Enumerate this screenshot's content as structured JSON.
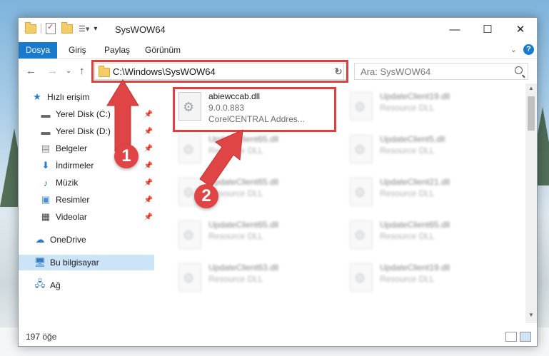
{
  "window": {
    "title": "SysWOW64"
  },
  "ribbon": {
    "tabs": [
      "Dosya",
      "Giriş",
      "Paylaş",
      "Görünüm"
    ]
  },
  "navigation": {
    "address": "C:\\Windows\\SysWOW64",
    "search_placeholder": "Ara: SysWOW64"
  },
  "sidebar": {
    "quick_access": "Hızlı erişim",
    "items": [
      {
        "label": "Yerel Disk (C:)",
        "icon": "drive-icon"
      },
      {
        "label": "Yerel Disk (D:)",
        "icon": "drive-icon"
      },
      {
        "label": "Belgeler",
        "icon": "documents-icon"
      },
      {
        "label": "İndirmeler",
        "icon": "downloads-icon"
      },
      {
        "label": "Müzik",
        "icon": "music-icon"
      },
      {
        "label": "Resimler",
        "icon": "pictures-icon"
      },
      {
        "label": "Videolar",
        "icon": "videos-icon"
      }
    ],
    "onedrive": "OneDrive",
    "this_pc": "Bu bilgisayar",
    "network": "Ağ"
  },
  "files": [
    {
      "name": "abiewccab.dll",
      "line2": "9.0.0.883",
      "line3": "CorelCENTRAL Addres..."
    },
    {
      "name": "UpdateClient19.dll",
      "line2": "Resource DLL"
    },
    {
      "name": "UpdateClient65.dll",
      "line2": "Resource DLL"
    },
    {
      "name": "UpdateClient5.dll",
      "line2": "Resource DLL"
    },
    {
      "name": "UpdateClient65.dll",
      "line2": "Resource DLL"
    },
    {
      "name": "UpdateClient21.dll",
      "line2": "Resource DLL"
    },
    {
      "name": "UpdateClient65.dll",
      "line2": "Resource DLL"
    },
    {
      "name": "UpdateClient65.dll",
      "line2": "Resource DLL"
    },
    {
      "name": "UpdateClient63.dll",
      "line2": "Resource DLL"
    },
    {
      "name": "UpdateClient19.dll",
      "line2": "Resource DLL"
    }
  ],
  "status": {
    "count": "197 öğe"
  },
  "annotations": {
    "step1": "1",
    "step2": "2"
  },
  "colors": {
    "accent": "#1979ca",
    "highlight": "#d9423e",
    "selected": "#cce4f7"
  }
}
